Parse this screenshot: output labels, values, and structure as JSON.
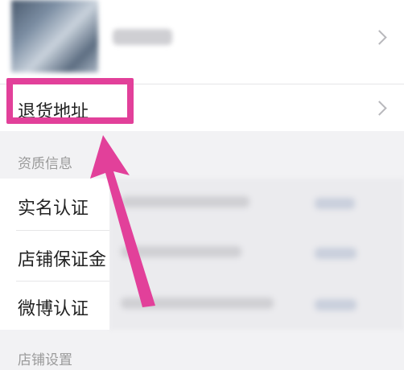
{
  "menu": {
    "return_address": "退货地址",
    "qualification_section": "资质信息",
    "items": [
      {
        "label": "实名认证"
      },
      {
        "label": "店铺保证金"
      },
      {
        "label": "微博认证"
      }
    ],
    "store_settings_section": "店铺设置"
  },
  "annotation": {
    "highlight_color": "#e2409a"
  }
}
